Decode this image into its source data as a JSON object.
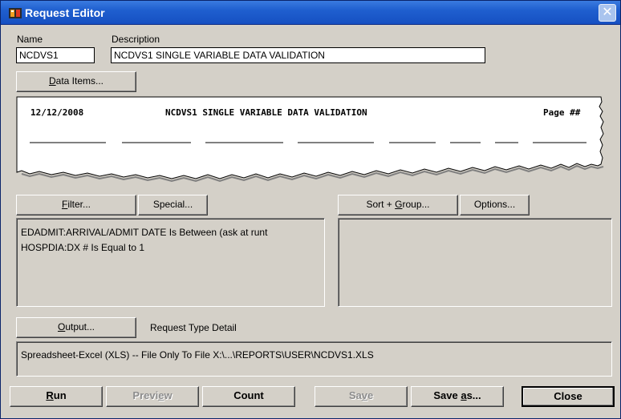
{
  "window": {
    "title": "Request Editor",
    "close_glyph": "✕"
  },
  "name": {
    "label": "Name",
    "value": "NCDVS1"
  },
  "description": {
    "label": "Description",
    "value": "NCDVS1 SINGLE VARIABLE DATA VALIDATION"
  },
  "buttons": {
    "data_items": {
      "prefix": "",
      "accel": "D",
      "rest": "ata Items..."
    },
    "filter": {
      "prefix": "",
      "accel": "F",
      "rest": "ilter..."
    },
    "special": {
      "label": "Special..."
    },
    "sort_group": {
      "prefix": "Sort + ",
      "accel": "G",
      "rest": "roup..."
    },
    "options": {
      "label": "Options..."
    },
    "output": {
      "prefix": "",
      "accel": "O",
      "rest": "utput..."
    },
    "run": {
      "prefix": "",
      "accel": "R",
      "rest": "un"
    },
    "preview": {
      "prefix": "Previ",
      "accel": "e",
      "rest": "w"
    },
    "count": {
      "label": "Count"
    },
    "save": {
      "prefix": "Sa",
      "accel": "v",
      "rest": "e"
    },
    "save_as": {
      "prefix": "Save ",
      "accel": "a",
      "rest": "s..."
    },
    "close": {
      "label": "Close"
    }
  },
  "preview": {
    "date": "12/12/2008",
    "title": "NCDVS1 SINGLE VARIABLE DATA VALIDATION",
    "page": "Page ##"
  },
  "filter_criteria": [
    "EDADMIT:ARRIVAL/ADMIT DATE Is Between (ask at runt",
    "HOSPDIA:DX # Is Equal to 1"
  ],
  "request_type_label": "Request Type Detail",
  "output_detail": "Spreadsheet-Excel (XLS) -- File Only To File X:\\...\\REPORTS\\USER\\NCDVS1.XLS",
  "colors": {
    "titlebar": "#1f5fcf",
    "dialog_bg": "#d4d0c8",
    "disabled_text": "#8c8c8c"
  }
}
